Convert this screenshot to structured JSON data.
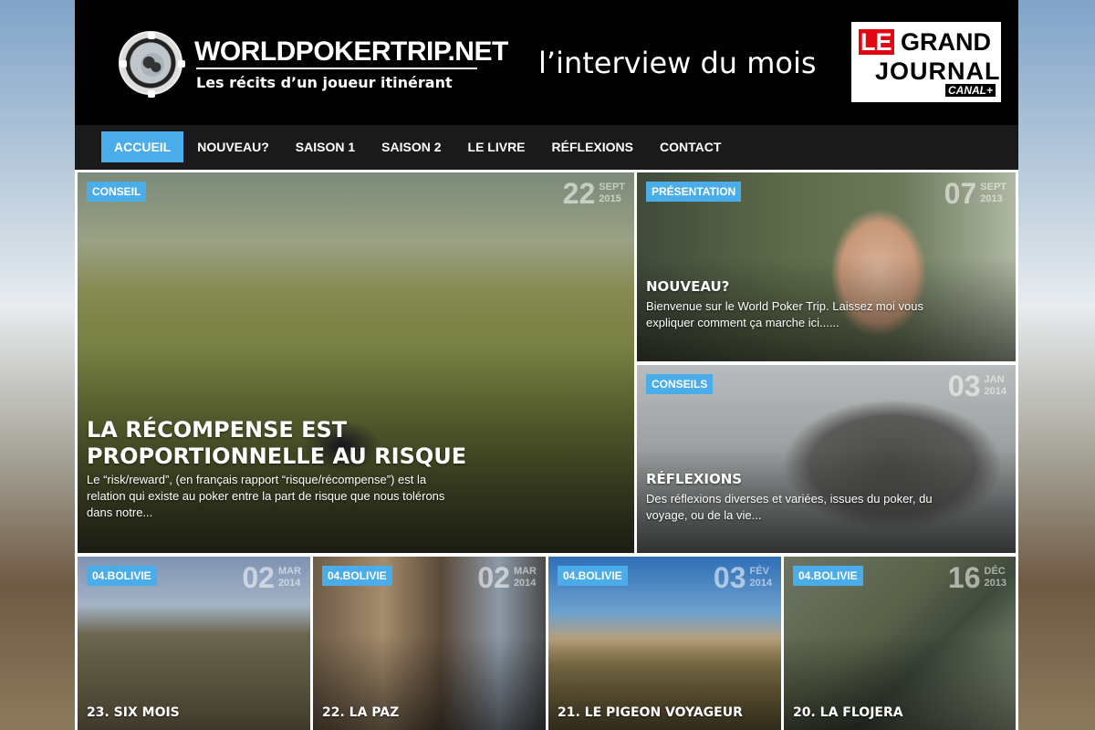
{
  "header": {
    "site_title": "WORLDPOKERTRIP.NET",
    "tagline": "Les récits d’un joueur itinérant",
    "interview": "l’interview du mois",
    "partner": {
      "le": "LE",
      "grand": "GRAND",
      "journal": "JOURNAL",
      "canal": "CANAL+"
    }
  },
  "nav": {
    "items": [
      "ACCUEIL",
      "NOUVEAU?",
      "SAISON 1",
      "SAISON 2",
      "LE LIVRE",
      "RÉFLEXIONS",
      "CONTACT"
    ],
    "active": "ACCUEIL"
  },
  "featured": {
    "main": {
      "tag": "CONSEIL",
      "day": "22",
      "month": "SEPT",
      "year": "2015",
      "title": "LA RÉCOMPENSE EST PROPORTIONNELLE AU RISQUE",
      "excerpt": "Le “risk/reward”, (en français rapport “risque/récompense”) est la relation qui existe au poker entre la part de risque que nous tolérons dans notre..."
    },
    "presentation": {
      "tag": "PRÉSENTATION",
      "day": "07",
      "month": "SEPT",
      "year": "2013",
      "title": "NOUVEAU?",
      "excerpt": "Bienvenue sur le World Poker Trip. Laissez moi vous expliquer comment ça marche ici......"
    },
    "reflexions": {
      "tag": "CONSEILS",
      "day": "03",
      "month": "JAN",
      "year": "2014",
      "title": "RÉFLEXIONS",
      "excerpt": "Des réflexions diverses et variées, issues du poker, du voyage, ou de la vie..."
    }
  },
  "stories": [
    {
      "tag": "04.BOLIVIE",
      "day": "02",
      "month": "MAR",
      "year": "2014",
      "title": "23. SIX MOIS"
    },
    {
      "tag": "04.BOLIVIE",
      "day": "02",
      "month": "MAR",
      "year": "2014",
      "title": "22. LA PAZ"
    },
    {
      "tag": "04.BOLIVIE",
      "day": "03",
      "month": "FÉV",
      "year": "2014",
      "title": "21. LE PIGEON VOYAGEUR"
    },
    {
      "tag": "04.BOLIVIE",
      "day": "16",
      "month": "DÉC",
      "year": "2013",
      "title": "20. LA FLOJERA"
    }
  ],
  "colors": {
    "accent": "#4aace8",
    "header_bg": "#000000",
    "nav_bg": "#1a1a1a"
  }
}
